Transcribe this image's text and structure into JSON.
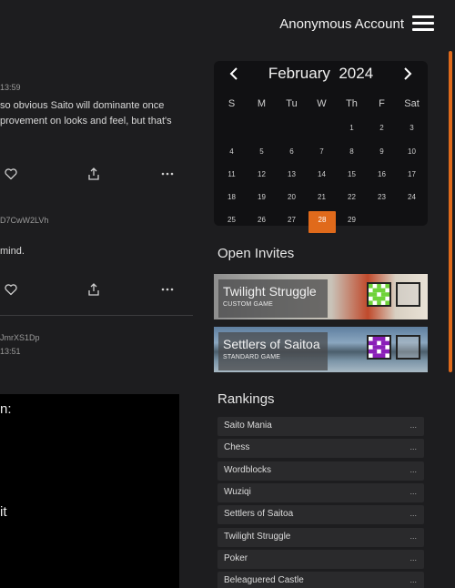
{
  "header": {
    "account_label": "Anonymous Account"
  },
  "feed": {
    "posts": [
      {
        "timestamp": "13:59",
        "text_line1": "so obvious Saito will dominante once",
        "text_line2": "provement on looks and feel, but that's"
      },
      {
        "timestamp": "D7CwW2LVh",
        "text_line1": "mind."
      },
      {
        "timestamp_line1": "JmrXS1Dp",
        "timestamp_line2": "13:51"
      }
    ],
    "embed_text1": "n:",
    "embed_text2": "it"
  },
  "calendar": {
    "month": "February",
    "year": "2024",
    "weekdays": [
      "S",
      "M",
      "Tu",
      "W",
      "Th",
      "F",
      "Sat"
    ],
    "leading_blanks": 4,
    "days": [
      "1",
      "2",
      "3",
      "4",
      "5",
      "6",
      "7",
      "8",
      "9",
      "10",
      "11",
      "12",
      "13",
      "14",
      "15",
      "16",
      "17",
      "18",
      "19",
      "20",
      "21",
      "22",
      "23",
      "24",
      "25",
      "26",
      "27",
      "28",
      "29"
    ],
    "today": "28",
    "accent_color": "#e06a1b"
  },
  "invites": {
    "title": "Open Invites",
    "items": [
      {
        "name": "Twilight Struggle",
        "type": "CUSTOM GAME",
        "player_color": "#6fd23a"
      },
      {
        "name": "Settlers of Saitoa",
        "type": "STANDARD GAME",
        "player_color": "#8a1fb8"
      }
    ]
  },
  "rankings": {
    "title": "Rankings",
    "items": [
      {
        "name": "Saito Mania",
        "value": "..."
      },
      {
        "name": "Chess",
        "value": "..."
      },
      {
        "name": "Wordblocks",
        "value": "..."
      },
      {
        "name": "Wuziqi",
        "value": "..."
      },
      {
        "name": "Settlers of Saitoa",
        "value": "..."
      },
      {
        "name": "Twilight Struggle",
        "value": "..."
      },
      {
        "name": "Poker",
        "value": "..."
      },
      {
        "name": "Beleaguered Castle",
        "value": "..."
      }
    ]
  }
}
